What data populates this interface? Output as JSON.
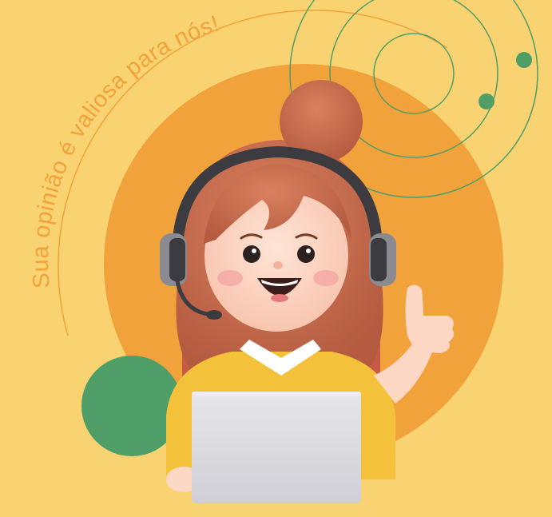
{
  "banner": {
    "headline": "Sua opinião é valiosa para nós!"
  },
  "colors": {
    "background": "#f9d372",
    "sun_orange": "#f2a23a",
    "accent_green": "#4f9e67",
    "text_orange": "#f2a23a",
    "hair": "#c96a4c",
    "shirt": "#f3c23a",
    "laptop": "#d9d9de",
    "headset": "#3c3c40"
  },
  "illustration": {
    "subject": "customer-support-agent-with-headset",
    "gesture": "thumbs-up"
  }
}
